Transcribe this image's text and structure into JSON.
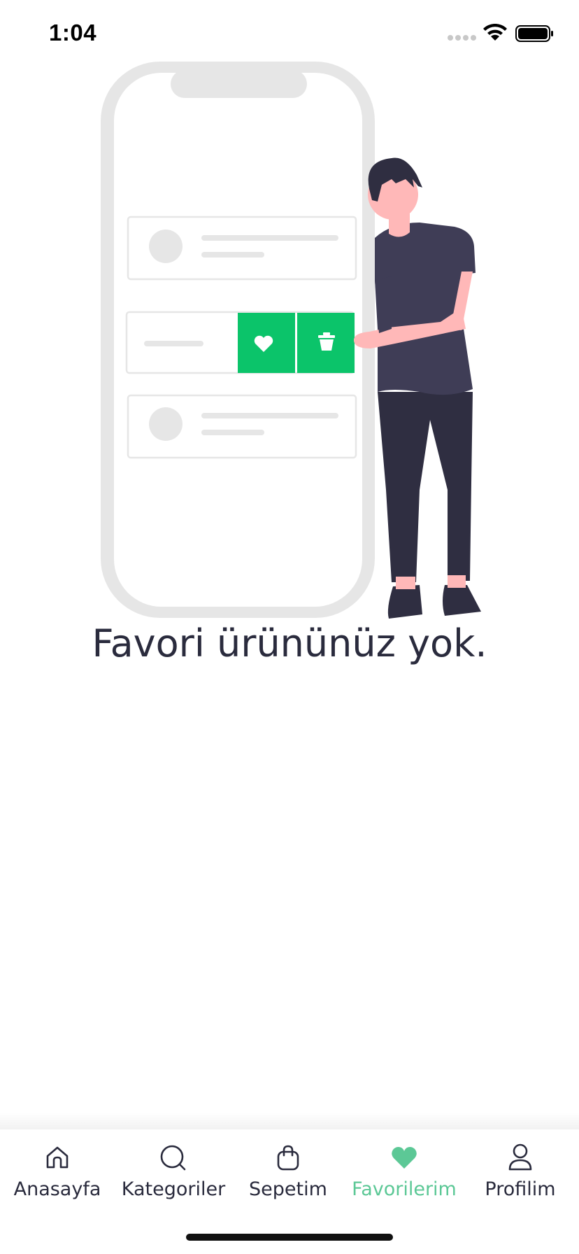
{
  "status_bar": {
    "time": "1:04"
  },
  "empty_state": {
    "message": "Favori ürününüz yok."
  },
  "tabbar": {
    "active_color": "#5cc896",
    "items": [
      {
        "label": "Anasayfa",
        "icon": "home-icon"
      },
      {
        "label": "Kategoriler",
        "icon": "search-icon"
      },
      {
        "label": "Sepetim",
        "icon": "shopping-bag-icon"
      },
      {
        "label": "Favorilerim",
        "icon": "heart-icon",
        "active": true
      },
      {
        "label": "Profilim",
        "icon": "user-icon"
      }
    ]
  },
  "colors": {
    "accent_green": "#0bc46a",
    "text_dark": "#2a2b3d"
  }
}
